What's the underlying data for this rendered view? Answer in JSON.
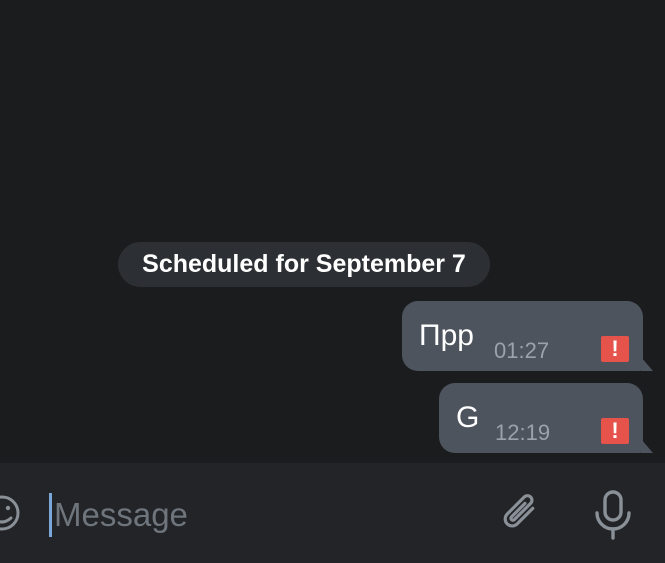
{
  "chat": {
    "date_label": "Scheduled for September 7",
    "messages": [
      {
        "text": "Прр",
        "time": "01:27",
        "status": "!"
      },
      {
        "text": "G",
        "time": "12:19",
        "status": "!"
      }
    ]
  },
  "composer": {
    "placeholder": "Message",
    "value": ""
  },
  "colors": {
    "background": "#1b1c1e",
    "bubble": "#4d545d",
    "date_pill": "#2c2f33",
    "error": "#e5534b",
    "composer": "#222427",
    "icon": "#8a9097"
  },
  "icons": [
    "emoji-icon",
    "error-icon",
    "paperclip-icon",
    "microphone-icon"
  ]
}
